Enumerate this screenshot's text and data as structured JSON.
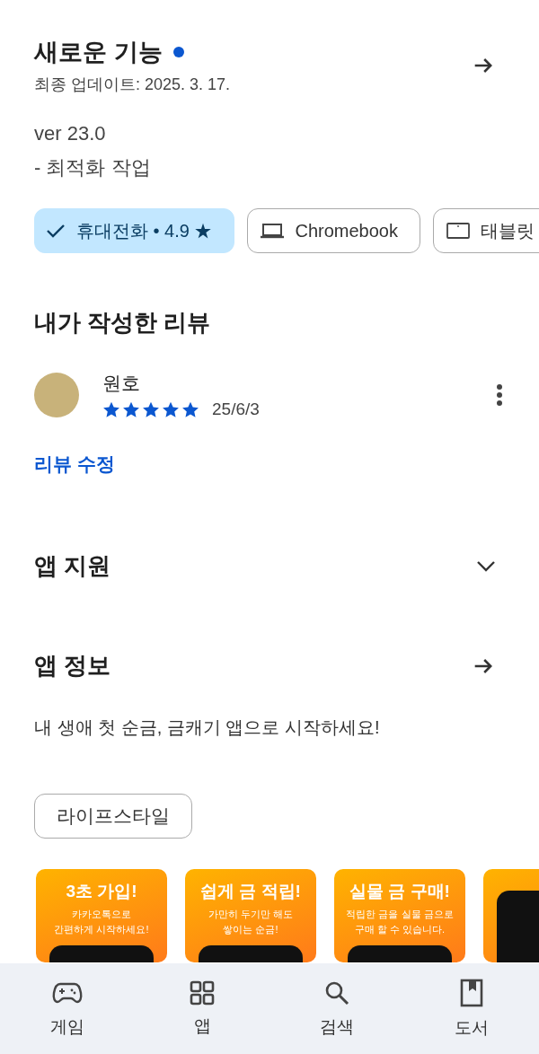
{
  "whats_new": {
    "title": "새로운 기능",
    "has_update": true,
    "updated": "최종 업데이트: 2025. 3. 17.",
    "notes": [
      "ver 23.0",
      "- 최적화 작업"
    ]
  },
  "device_chips": [
    {
      "kind": "phone",
      "label": "휴대전화 • 4.9 ★",
      "selected": true
    },
    {
      "kind": "laptop",
      "label": "Chromebook",
      "selected": false
    },
    {
      "kind": "tablet",
      "label": "태블릿",
      "selected": false
    }
  ],
  "my_review": {
    "heading": "내가 작성한 리뷰",
    "author": "원호",
    "stars": 5,
    "date": "25/6/3",
    "edit_link": "리뷰 수정"
  },
  "app_support": {
    "title": "앱 지원",
    "expanded": false
  },
  "app_info": {
    "title": "앱 정보",
    "description": "내 생애 첫 순금, 금캐기 앱으로 시작하세요!",
    "category": "라이프스타일"
  },
  "screenshots": [
    {
      "kind": "promo",
      "headline": "3초 가입!",
      "caption": [
        "카카오톡으로",
        "간편하게 시작하세요!"
      ]
    },
    {
      "kind": "promo",
      "headline": "쉽게 금 적립!",
      "caption": [
        "가만히 두기만 해도",
        "쌓이는 순금!"
      ]
    },
    {
      "kind": "promo",
      "headline": "실물 금 구매!",
      "caption": [
        "적립한 금을 실물 금으로",
        "구매 할 수 있습니다."
      ]
    },
    {
      "kind": "cut_off"
    }
  ],
  "nav": [
    {
      "kind": "games",
      "label": "게임",
      "selected": false
    },
    {
      "kind": "apps",
      "label": "앱",
      "selected": false
    },
    {
      "kind": "search",
      "label": "검색",
      "selected": false
    },
    {
      "kind": "books",
      "label": "도서",
      "selected": false
    }
  ]
}
